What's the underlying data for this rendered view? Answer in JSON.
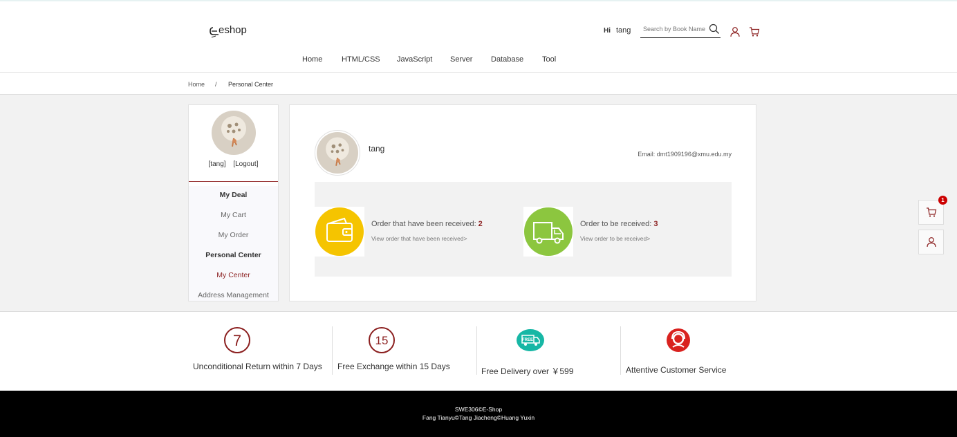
{
  "header": {
    "logo_text": "eshop",
    "greeting": "Hi",
    "username": "tang",
    "search_placeholder": "Search by Book Name"
  },
  "nav": [
    "Home",
    "HTML/CSS",
    "JavaScript",
    "Server",
    "Database",
    "Tool"
  ],
  "breadcrumb": {
    "home": "Home",
    "separator": "/",
    "current": "Personal Center"
  },
  "sidebar": {
    "user_link": "[tang]",
    "logout_link": "[Logout]",
    "menu": [
      {
        "label": "My Deal",
        "type": "heading"
      },
      {
        "label": "My Cart",
        "type": "link"
      },
      {
        "label": "My Order",
        "type": "link"
      },
      {
        "label": "Personal Center",
        "type": "heading"
      },
      {
        "label": "My Center",
        "type": "active"
      },
      {
        "label": "Address Management",
        "type": "link"
      }
    ]
  },
  "profile": {
    "name": "tang",
    "email": "Email: dmt1909196@xmu.edu.my"
  },
  "stats": [
    {
      "label": "Order that have been received:",
      "count": "2",
      "link": "View order that have been received>",
      "icon": "wallet-icon",
      "color": "#f5c400"
    },
    {
      "label": "Order to be received:",
      "count": "3",
      "link": "View order to be received>",
      "icon": "truck-icon",
      "color": "#8cc63f"
    }
  ],
  "floating": {
    "cart_badge": "1"
  },
  "services": [
    {
      "badge": "7",
      "text": "Unconditional Return within 7 Days",
      "icon": "seven-days-icon"
    },
    {
      "badge": "15",
      "text": "Free Exchange within 15 Days",
      "icon": "fifteen-days-icon"
    },
    {
      "badge": "FREE",
      "text": "Free Delivery over ￥599",
      "icon": "free-delivery-icon"
    },
    {
      "badge": "",
      "text": "Attentive Customer Service",
      "icon": "customer-service-icon"
    }
  ],
  "footer": {
    "line1": "SWE306©E-Shop",
    "line2": "Fang Tianyu©Tang Jiacheng©Huang Yuxin"
  },
  "colors": {
    "accent": "#8b1f1f",
    "wallet": "#f5c400",
    "truck": "#8cc63f",
    "delivery": "#17b7a5",
    "service": "#d9221f"
  }
}
